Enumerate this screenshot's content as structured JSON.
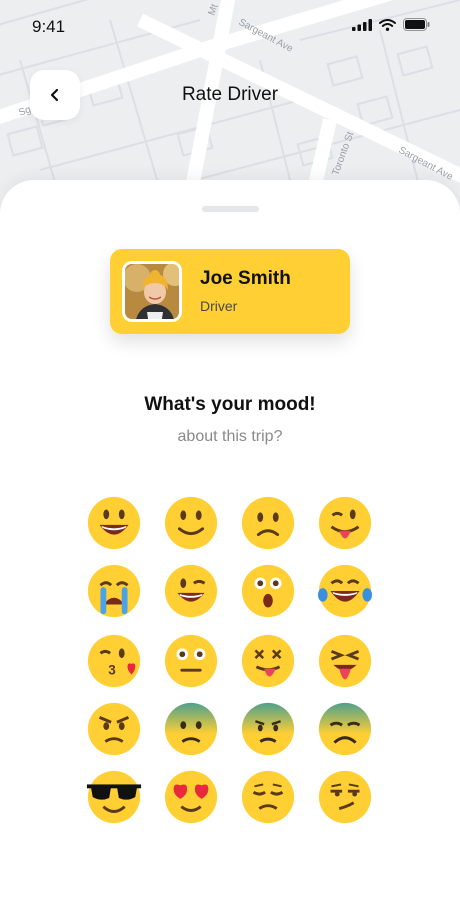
{
  "status_bar": {
    "time": "9:41"
  },
  "map": {
    "street_labels": [
      "Sargeant Ave",
      "Sargeant Ave",
      "Mt",
      "Sg",
      "Toronto St"
    ]
  },
  "header": {
    "title": "Rate Driver"
  },
  "driver": {
    "name": "Joe Smith",
    "role": "Driver"
  },
  "mood": {
    "title": "What's your mood!",
    "subtitle": "about this trip?"
  },
  "emojis": [
    "grinning",
    "smiling",
    "frowning",
    "winking-tongue",
    "crying",
    "winking-smile",
    "surprised",
    "laughing-tears",
    "kissing",
    "neutral",
    "dizzy-tongue",
    "tongue-out",
    "angry",
    "anxious-green",
    "sick-green",
    "disappointed-green",
    "cool-sunglasses",
    "heart-eyes",
    "relieved",
    "smirking"
  ],
  "colors": {
    "accent": "#FFCF33",
    "sheet": "#FFFFFF",
    "map": "#ECEEF0"
  }
}
